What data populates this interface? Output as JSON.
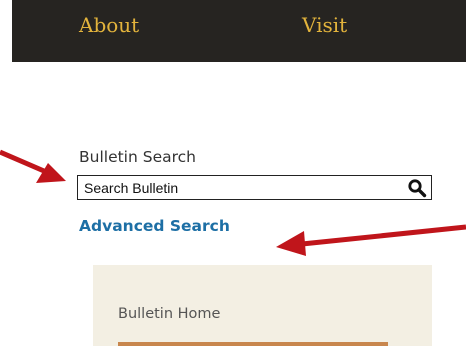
{
  "top_nav": {
    "items": [
      {
        "label": "About"
      },
      {
        "label": "Visit"
      }
    ]
  },
  "bulletin_search": {
    "heading": "Bulletin Search",
    "input_value": "Search Bulletin",
    "advanced_link": "Advanced Search"
  },
  "side_panel": {
    "items": [
      {
        "label": "Bulletin Home"
      }
    ]
  },
  "colors": {
    "nav_background": "#262421",
    "nav_link": "#e2b33c",
    "link_blue": "#1d6fa5",
    "panel_background": "#f3efe3",
    "annotation_arrow": "#c0151b"
  },
  "icons": {
    "search": "magnifier-icon",
    "annotation": "arrow-icon"
  }
}
